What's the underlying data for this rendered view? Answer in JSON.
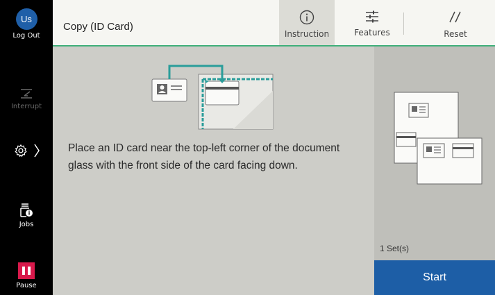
{
  "rail": {
    "avatar_initials": "Us",
    "logout_label": "Log Out",
    "interrupt_label": "Interrupt",
    "jobs_label": "Jobs",
    "pause_label": "Pause"
  },
  "header": {
    "title": "Copy (ID Card)",
    "instruction_label": "Instruction",
    "features_label": "Features",
    "reset_label": "Reset"
  },
  "main": {
    "instruction_text": "Place an ID card near the top-left corner of the document glass with the front side of the card facing down."
  },
  "right_panel": {
    "sets_label": "1 Set(s)"
  },
  "start_label": "Start",
  "colors": {
    "accent_green": "#3fb07a",
    "start_blue": "#1d5ea6",
    "pause_red": "#d8194b",
    "glass_teal": "#2a9d9a"
  }
}
